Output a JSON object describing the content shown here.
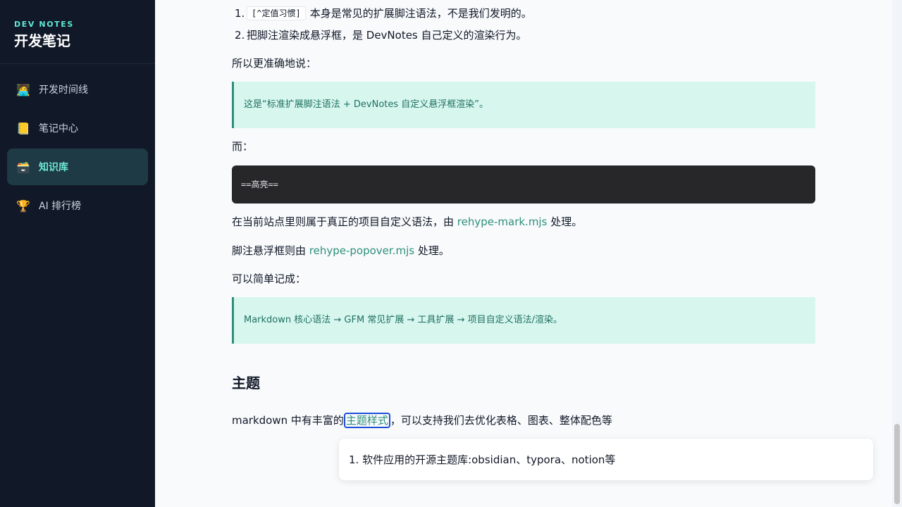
{
  "sidebar": {
    "brand_sub": "DEV NOTES",
    "brand_title": "开发笔记",
    "items": [
      {
        "label": "开发时间线",
        "icon": "developer-icon",
        "glyph": "🧑‍💻"
      },
      {
        "label": "笔记中心",
        "icon": "scroll-icon",
        "glyph": "📒"
      },
      {
        "label": "知识库",
        "icon": "archive-box-icon",
        "glyph": "🗃️"
      },
      {
        "label": "AI 排行榜",
        "icon": "trophy-icon",
        "glyph": "🏆"
      }
    ],
    "active_index": 2
  },
  "article": {
    "list": [
      {
        "num": "1.",
        "code": "[^定值习惯]",
        "text": "本身是常见的扩展脚注语法，不是我们发明的。"
      },
      {
        "num": "2.",
        "text": "把脚注渲染成悬浮框，是 DevNotes 自己定义的渲染行为。"
      }
    ],
    "p1": "所以更准确地说：",
    "callout1": "这是“标准扩展脚注语法 + DevNotes 自定义悬浮框渲染”。",
    "p2": "而：",
    "codeblock": "==高亮==",
    "p3_before": "在当前站点里则属于真正的项目自定义语法，由 ",
    "p3_link": "rehype-mark.mjs",
    "p3_after": " 处理。",
    "p4_before": "脚注悬浮框则由 ",
    "p4_link": "rehype-popover.mjs",
    "p4_after": " 处理。",
    "p5": "可以简单记成：",
    "callout2": "Markdown 核心语法 → GFM 常见扩展 → 工具扩展 → 项目自定义语法/渲染。",
    "heading": "主题",
    "p6_before": "markdown 中有丰富的",
    "p6_link": "主题样式",
    "p6_after": "，可以支持我们去优化表格、图表、整体配色等"
  },
  "popover": {
    "text": "1. 软件应用的开源主题库:obsidian、typora、notion等"
  },
  "colors": {
    "sidebar_bg": "#111827",
    "accent": "#2f8f7c",
    "callout_bg": "#d7f7ee",
    "active_item_bg": "#1e3a44"
  }
}
